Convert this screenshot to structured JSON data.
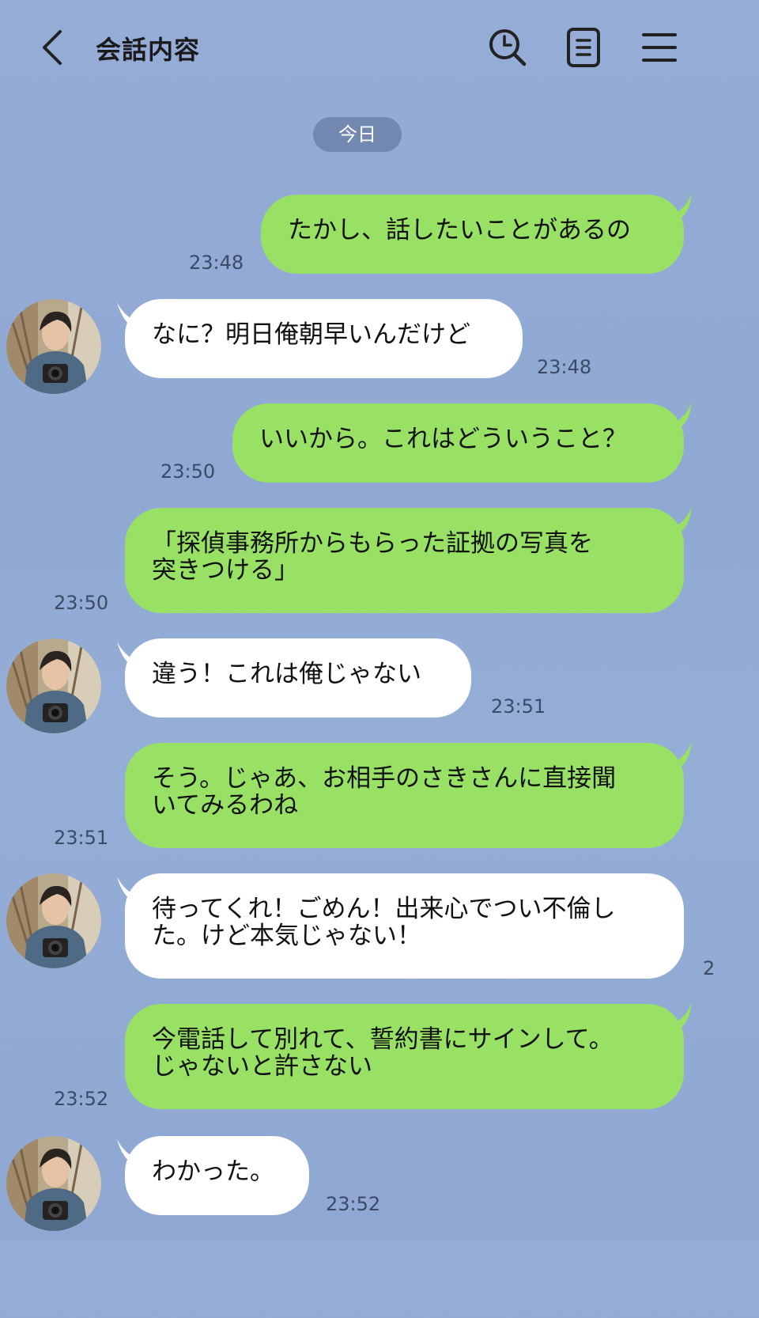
{
  "header": {
    "title": "会話内容",
    "icons": [
      "back-arrow-icon",
      "search-icon",
      "notes-icon",
      "menu-icon"
    ]
  },
  "date_label": "今日",
  "colors": {
    "sent": "#98e165",
    "received": "#ffffff",
    "background": "#92abd5"
  },
  "messages": [
    {
      "side": "sent",
      "lines": [
        "たかし、話したいことがあるの"
      ],
      "time": "23:48"
    },
    {
      "side": "received",
      "lines": [
        "なに？明日俺朝早いんだけど"
      ],
      "time": "23:48"
    },
    {
      "side": "sent",
      "lines": [
        "いいから。これはどういうこと？"
      ],
      "time": "23:50"
    },
    {
      "side": "sent",
      "lines": [
        "「探偵事務所からもらった証拠の写真を",
        "突きつける」"
      ],
      "time": "23:50"
    },
    {
      "side": "received",
      "lines": [
        "違う！これは俺じゃない"
      ],
      "time": "23:51"
    },
    {
      "side": "sent",
      "lines": [
        "そう。じゃあ、お相手のさきさんに直接聞",
        "いてみるわね"
      ],
      "time": "23:51"
    },
    {
      "side": "received",
      "lines": [
        "待ってくれ！ごめん！出来心でつい不倫し",
        "た。けど本気じゃない！"
      ],
      "time": "2"
    },
    {
      "side": "sent",
      "lines": [
        "今電話して別れて、誓約書にサインして。",
        "じゃないと許さない"
      ],
      "time": "23:52"
    },
    {
      "side": "received",
      "lines": [
        "わかった。"
      ],
      "time": "23:52"
    }
  ]
}
